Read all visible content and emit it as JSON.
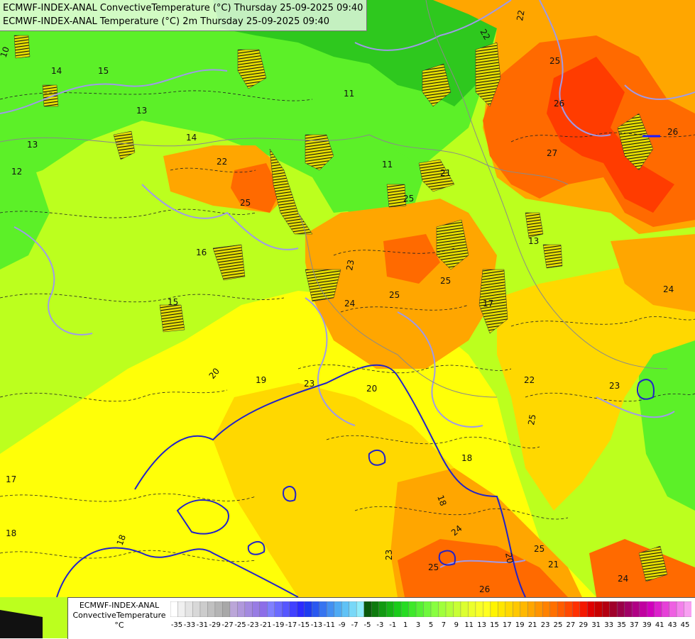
{
  "titles": {
    "line1": "ECMWF-INDEX-ANAL ConvectiveTemperature (°C) Thursday 25-09-2025 09:40",
    "line2": "ECMWF-INDEX-ANAL Temperature (°C) 2m Thursday 25-09-2025 09:40"
  },
  "legend": {
    "line1": "ECMWF-INDEX-ANAL",
    "line2": "ConvectiveTemperature",
    "line3": "°C",
    "ticks": [
      "-35",
      "-33",
      "-31",
      "-29",
      "-27",
      "-25",
      "-23",
      "-21",
      "-19",
      "-17",
      "-15",
      "-13",
      "-11",
      "-9",
      "-7",
      "-5",
      "-3",
      "-1",
      "1",
      "3",
      "5",
      "7",
      "9",
      "11",
      "13",
      "15",
      "17",
      "19",
      "21",
      "23",
      "25",
      "27",
      "29",
      "31",
      "33",
      "35",
      "37",
      "39",
      "41",
      "43",
      "45"
    ],
    "colors": [
      "#ffffff",
      "#f0f0f0",
      "#e4e4e4",
      "#d8d8d8",
      "#cccccc",
      "#c0c0c0",
      "#b4b4b4",
      "#a8a8a8",
      "#bba6d8",
      "#b098dc",
      "#a48ae0",
      "#987ce4",
      "#8c6ee8",
      "#8080ff",
      "#6b6bff",
      "#5656ff",
      "#4141ff",
      "#2c2cff",
      "#1e3cf0",
      "#2a58f0",
      "#3674f0",
      "#4290f2",
      "#4eaaf4",
      "#60c2f6",
      "#78d8f8",
      "#90ecfa",
      "#0a5a0a",
      "#0e7a0e",
      "#129a12",
      "#16b416",
      "#1acc1a",
      "#26dc22",
      "#3ee82a",
      "#56f034",
      "#6ef83c",
      "#88ff40",
      "#a0ff3c",
      "#b4ff38",
      "#c8ff34",
      "#dcff30",
      "#ecff2c",
      "#f8ff28",
      "#ffff20",
      "#fff400",
      "#ffe600",
      "#ffd800",
      "#ffc800",
      "#ffb800",
      "#ffa600",
      "#ff9400",
      "#ff8200",
      "#ff7000",
      "#ff5c00",
      "#ff4800",
      "#ff3000",
      "#f41800",
      "#e00000",
      "#c80000",
      "#b40010",
      "#a0002a",
      "#9a0048",
      "#a00066",
      "#b00084",
      "#c000a0",
      "#d000bc",
      "#dc20cc",
      "#e640d8",
      "#ee60e2",
      "#f480ec",
      "#f8a0f2"
    ]
  },
  "map": {
    "contour_labels": [
      "10",
      "14",
      "15",
      "13",
      "12",
      "13",
      "14",
      "22",
      "22",
      "25",
      "25",
      "11",
      "11",
      "22",
      "24",
      "25",
      "26",
      "27",
      "26",
      "21",
      "23",
      "24",
      "25",
      "25",
      "17",
      "16",
      "15",
      "20",
      "20",
      "19",
      "23",
      "22",
      "25",
      "23",
      "18",
      "18",
      "17",
      "18",
      "18",
      "24",
      "20",
      "25",
      "26",
      "25",
      "24",
      "21",
      "23",
      "13"
    ],
    "colors": {
      "green_dark": "#2ec81e",
      "green": "#5cf028",
      "yellow_green": "#bcff1e",
      "yellow": "#ffff08",
      "yellow_orange": "#ffd800",
      "orange": "#ffa600",
      "red_orange": "#ff6a00",
      "red": "#ff3c00",
      "contour_blue": "#2222c8",
      "contour_lavender": "#9f9ae8"
    }
  }
}
